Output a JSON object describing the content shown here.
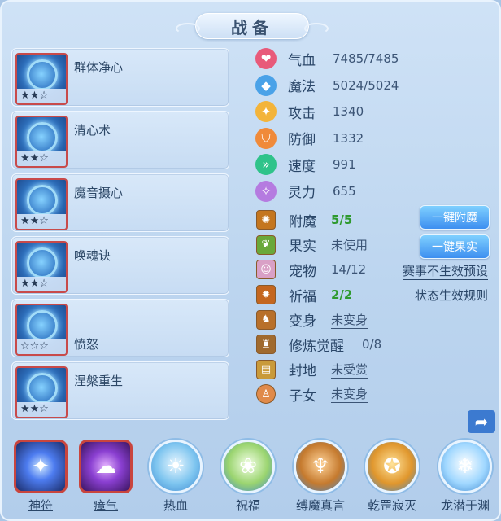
{
  "title": "战备",
  "skills": [
    {
      "name": "群体净心",
      "stars": "★★☆",
      "color": "#2f63b8"
    },
    {
      "name": "清心术",
      "stars": "★★☆",
      "color": "#2f74c3"
    },
    {
      "name": "魔音摄心",
      "stars": "★★☆",
      "color": "#2b6fc2"
    },
    {
      "name": "唤魂诀",
      "stars": "★★☆",
      "color": "#3b7fce"
    },
    {
      "name": "愤怒",
      "stars": "☆☆☆",
      "color": "#2a6bb9"
    },
    {
      "name": "涅槃重生",
      "stars": "★★☆",
      "color": "#3a83d0"
    }
  ],
  "attributes": [
    {
      "icon": "heart-icon",
      "label": "气血",
      "value": "7485/7485",
      "color": "#e85a7a"
    },
    {
      "icon": "droplet-icon",
      "label": "魔法",
      "value": "5024/5024",
      "color": "#4aa2e8"
    },
    {
      "icon": "sword-icon",
      "label": "攻击",
      "value": "1340",
      "color": "#f3b43a"
    },
    {
      "icon": "shield-icon",
      "label": "防御",
      "value": "1332",
      "color": "#f08a3a"
    },
    {
      "icon": "speed-icon",
      "label": "速度",
      "value": "991",
      "color": "#2fc38a"
    },
    {
      "icon": "spirit-icon",
      "label": "灵力",
      "value": "655",
      "color": "#b57be0"
    }
  ],
  "extras": [
    {
      "icon": "enchant-icon",
      "label": "附魔",
      "value": "5/5",
      "style": "green",
      "color": "#c4761f"
    },
    {
      "icon": "fruit-icon",
      "label": "果实",
      "value": "未使用",
      "style": "plain",
      "color": "#6aa83a"
    },
    {
      "icon": "pet-icon",
      "label": "宠物",
      "value": "14/12",
      "style": "plain",
      "color": "#d9a0c6"
    },
    {
      "icon": "pray-icon",
      "label": "祈福",
      "value": "2/2",
      "style": "green",
      "color": "#c4661f"
    },
    {
      "icon": "transform-icon",
      "label": "变身",
      "value": "未变身",
      "style": "link",
      "color": "#b8702a"
    },
    {
      "icon": "cultivate-icon",
      "label": "修炼觉醒",
      "value": "0/8",
      "style": "link",
      "color": "#a06a2e"
    },
    {
      "icon": "fief-icon",
      "label": "封地",
      "value": "未受赏",
      "style": "link",
      "color": "#c99a3a"
    },
    {
      "icon": "child-icon",
      "label": "子女",
      "value": "未变身",
      "style": "link",
      "color": "#e08a4a"
    }
  ],
  "buttons": {
    "enchant": "一键附魔",
    "fruit": "一键果实"
  },
  "links": {
    "event_preset": "赛事不生效预设",
    "status_rules": "状态生效规则"
  },
  "bottom_items": [
    {
      "label": "神符",
      "shape": "sq",
      "color": "#4d7cf0",
      "underline": true
    },
    {
      "label": "瘴气",
      "shape": "sq",
      "color": "#8a3fd1",
      "underline": true
    },
    {
      "label": "热血",
      "shape": "round",
      "color": "#5fb6e8",
      "underline": false
    },
    {
      "label": "祝福",
      "shape": "round",
      "color": "#7cc86a",
      "underline": false
    },
    {
      "label": "缚魔真言",
      "shape": "round",
      "color": "#c57a2e",
      "underline": false
    },
    {
      "label": "乾罡寂灭",
      "shape": "round",
      "color": "#e0962c",
      "underline": false
    },
    {
      "label": "龙潜于渊",
      "shape": "round",
      "color": "#9fd7ff",
      "underline": false
    }
  ]
}
